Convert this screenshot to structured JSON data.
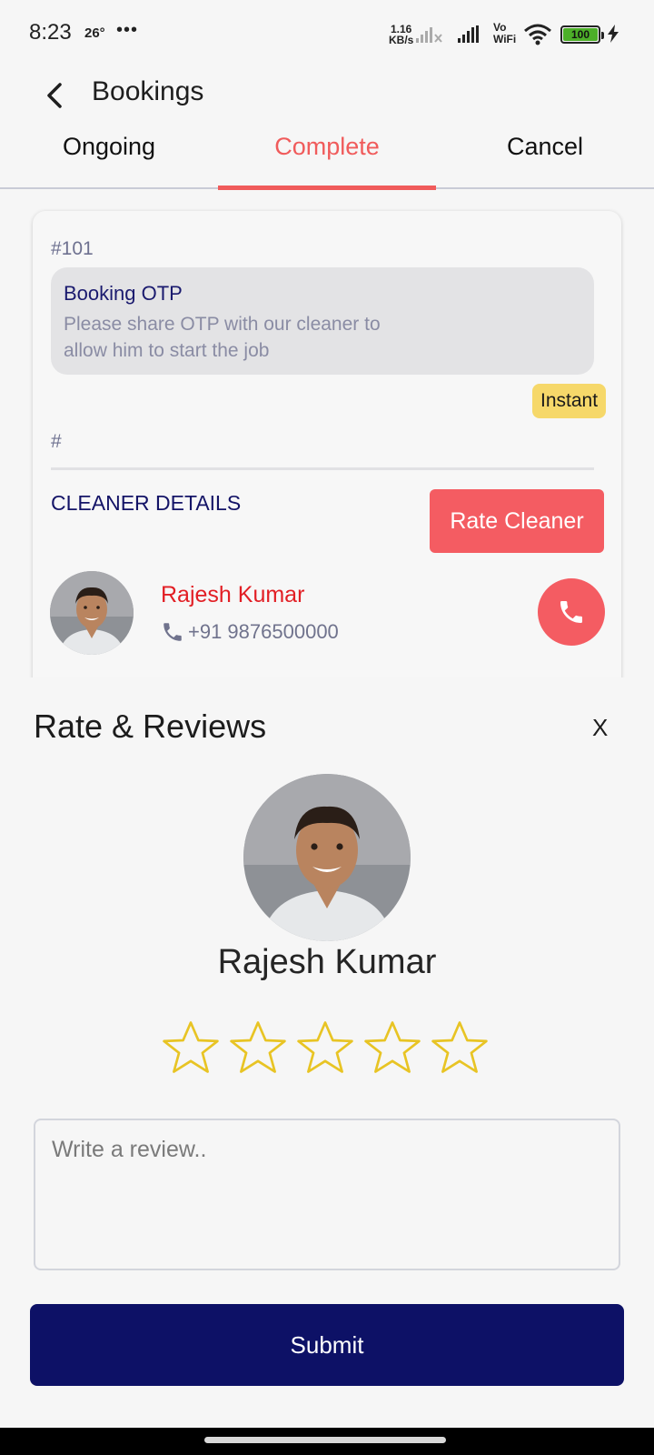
{
  "status_bar": {
    "time": "8:23",
    "temperature": "26°",
    "more": "•••",
    "net_speed_value": "1.16",
    "net_speed_unit": "KB/s",
    "vo_label": "Vo",
    "wifi_label": "WiFi",
    "battery": "100"
  },
  "header": {
    "title": "Bookings"
  },
  "tabs": [
    {
      "label": "Ongoing",
      "active": false
    },
    {
      "label": "Complete",
      "active": true
    },
    {
      "label": "Cancel",
      "active": false
    }
  ],
  "booking": {
    "id": "#101",
    "otp_title": "Booking OTP",
    "otp_text": "Please share OTP with our cleaner to allow him to start the job",
    "badge": "Instant",
    "hash": "#",
    "cleaner_heading": "CLEANER DETAILS",
    "rate_button": "Rate Cleaner",
    "cleaner_name": "Rajesh Kumar",
    "cleaner_phone": "+91 9876500000"
  },
  "review_sheet": {
    "title": "Rate & Reviews",
    "close_label": "X",
    "cleaner_name": "Rajesh Kumar",
    "rating": 0,
    "max_rating": 5,
    "review_placeholder": "Write a review..",
    "submit_label": "Submit"
  },
  "colors": {
    "accent": "#f05b5b",
    "primary": "#0d1166",
    "badge": "#f6d86a",
    "star": "#e8c424"
  }
}
